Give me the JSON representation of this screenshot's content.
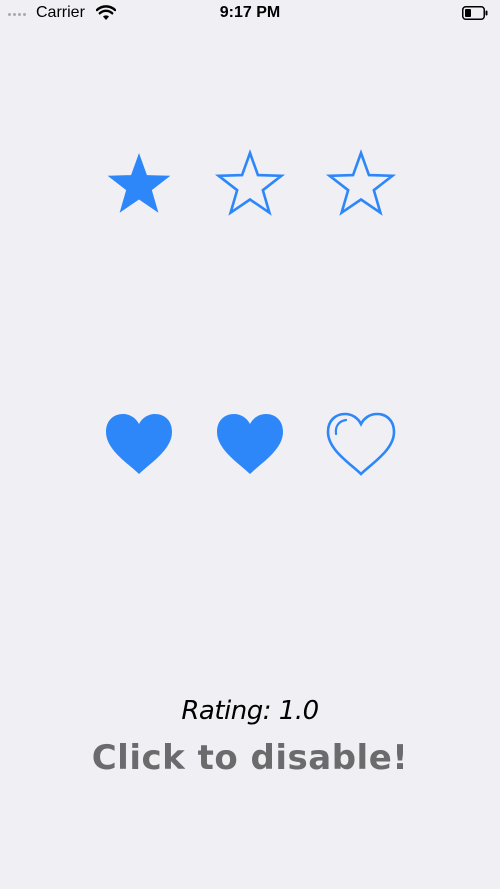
{
  "status_bar": {
    "carrier": "Carrier",
    "time": "9:17 PM"
  },
  "theme": {
    "accent": "#2d87f9",
    "background": "#efeff4",
    "button_text": "#6b6b6e"
  },
  "stars": {
    "count": 3,
    "rating": 1,
    "icon": "star-icon"
  },
  "hearts": {
    "count": 3,
    "rating": 2,
    "icon": "heart-icon"
  },
  "rating_label": "Rating: 1.0",
  "disable_button_label": "Click to disable!"
}
